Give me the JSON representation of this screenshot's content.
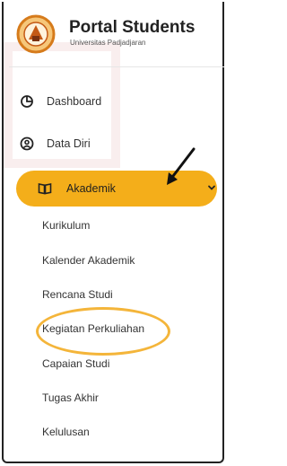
{
  "brand": {
    "title": "Portal Students",
    "subtitle": "Universitas Padjadjaran",
    "colors": {
      "accent": "#f4ae1a",
      "logo_ring": "#d67b1b",
      "highlight": "#f4b53a"
    }
  },
  "nav": {
    "items": [
      {
        "label": "Dashboard",
        "icon": "pie-chart-icon"
      },
      {
        "label": "Data Diri",
        "icon": "user-circle-icon"
      }
    ],
    "active": {
      "label": "Akademik",
      "icon": "book-open-icon",
      "expanded": true,
      "chevron_icon": "chevron-down-icon"
    },
    "sub_items": [
      "Kurikulum",
      "Kalender Akademik",
      "Rencana Studi",
      "Kegiatan Perkuliahan",
      "Capaian Studi",
      "Tugas Akhir",
      "Kelulusan"
    ],
    "highlighted_sub_item": "Kegiatan Perkuliahan"
  },
  "annotations": {
    "arrow_icon": "pointer-arrow-icon"
  }
}
